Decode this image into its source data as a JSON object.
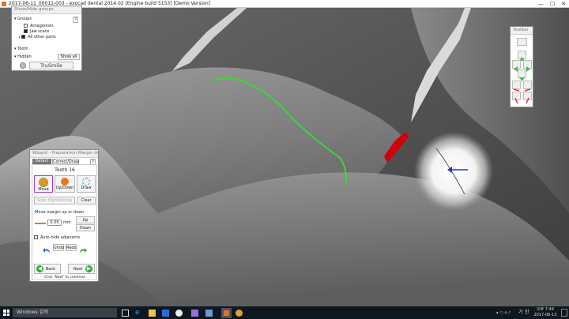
{
  "window": {
    "title": "2017-06-11_00011-003 - exocad dental 2014.02 [Engine build 5153] [Demo Version]"
  },
  "window_controls": [
    "—",
    "☐",
    "✕"
  ],
  "showhide": {
    "header": "Show/Hide groups",
    "groups_label": "Groups",
    "help": "?",
    "items": [
      "Antagonists",
      "Jaw scans",
      "All other parts"
    ],
    "tooth_label": "Tooth",
    "hidden_label": "Hidden",
    "show_all": "Show all",
    "logo_text": "TruSmile"
  },
  "toolbar": {
    "header": "Toolbar"
  },
  "wizard": {
    "header": "Wizard - Preparation Margin detector",
    "help": "?",
    "tabs": [
      "Detect",
      "Correct/Draw"
    ],
    "tooth": "Tooth 16",
    "tools": [
      "Move",
      "Up/Down",
      "Draw"
    ],
    "greyed_button": "Scan Highlighting",
    "clear": "Clear",
    "move_label": "Move margin up or down",
    "value": "0.05",
    "unit": "mm",
    "up": "Up",
    "down": "Down",
    "autohide": "Auto-hide adjacents",
    "undo": "Undo",
    "redo": "Redo",
    "back": "Back",
    "next": "Next",
    "hint": "Click 'Next' to continue"
  },
  "taskbar": {
    "search": "Windows 검색",
    "ime": "가",
    "lang": "한",
    "time": "오후 7:44",
    "date": "2017-06-13"
  },
  "colors": {
    "margin_line": "#39d834",
    "red_area": "#d0000a",
    "cursor_arrow": "#2233cc",
    "taskbar": "#0f1720"
  }
}
